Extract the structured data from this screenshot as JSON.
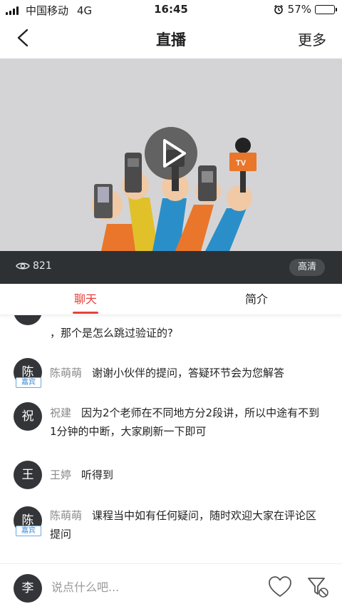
{
  "status_bar": {
    "carrier": "中国移动",
    "network": "4G",
    "time": "16:45",
    "battery": "57%",
    "battery_level": 0.57
  },
  "header": {
    "title": "直播",
    "more_label": "更多"
  },
  "video": {
    "view_count": "821",
    "quality_label": "高清",
    "play_icon": "play-icon"
  },
  "tabs": [
    {
      "label": "聊天",
      "active": true
    },
    {
      "label": "简介",
      "active": false
    }
  ],
  "chat": {
    "messages": [
      {
        "avatar": "",
        "badge": "",
        "sender": "",
        "text": "，那个是怎么跳过验证的?"
      },
      {
        "avatar": "陈",
        "badge": "嘉宾",
        "sender": "陈萌萌",
        "text": "谢谢小伙伴的提问，答疑环节会为您解答"
      },
      {
        "avatar": "祝",
        "badge": "",
        "sender": "祝建",
        "text": "因为2个老师在不同地方分2段讲，所以中途有不到1分钟的中断，大家刷新一下即可"
      },
      {
        "avatar": "王",
        "badge": "",
        "sender": "王婷",
        "text": "听得到"
      },
      {
        "avatar": "陈",
        "badge": "嘉宾",
        "sender": "陈萌萌",
        "text": "课程当中如有任何疑问，随时欢迎大家在评论区提问"
      }
    ]
  },
  "input_bar": {
    "avatar": "李",
    "placeholder": "说点什么吧..."
  },
  "colors": {
    "accent": "#e8403b",
    "badge_blue": "#3a8ad6",
    "avatar_bg": "#333538",
    "video_bar": "#2e3134"
  }
}
